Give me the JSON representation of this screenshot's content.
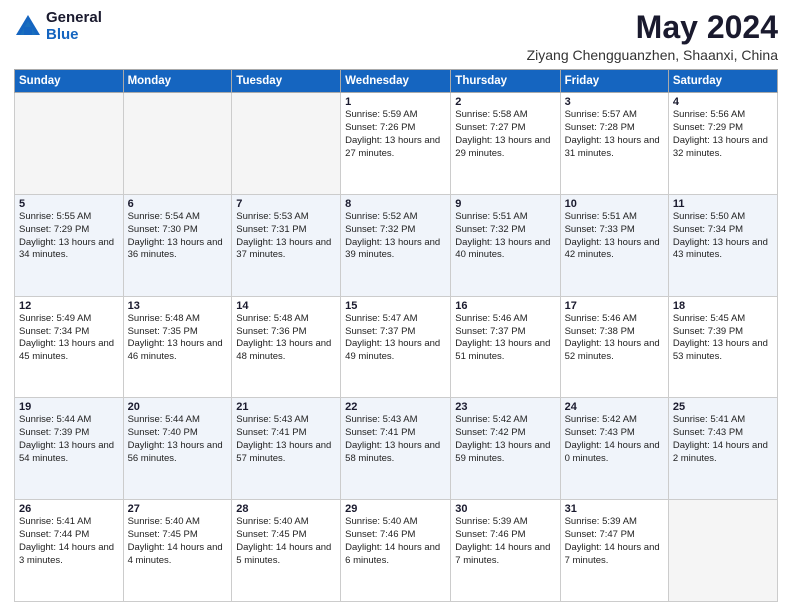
{
  "logo": {
    "general": "General",
    "blue": "Blue"
  },
  "title": "May 2024",
  "location": "Ziyang Chengguanzhen, Shaanxi, China",
  "days_of_week": [
    "Sunday",
    "Monday",
    "Tuesday",
    "Wednesday",
    "Thursday",
    "Friday",
    "Saturday"
  ],
  "weeks": [
    [
      {
        "day": "",
        "sunrise": "",
        "sunset": "",
        "daylight": "",
        "empty": true
      },
      {
        "day": "",
        "sunrise": "",
        "sunset": "",
        "daylight": "",
        "empty": true
      },
      {
        "day": "",
        "sunrise": "",
        "sunset": "",
        "daylight": "",
        "empty": true
      },
      {
        "day": "1",
        "sunrise": "Sunrise: 5:59 AM",
        "sunset": "Sunset: 7:26 PM",
        "daylight": "Daylight: 13 hours and 27 minutes.",
        "empty": false
      },
      {
        "day": "2",
        "sunrise": "Sunrise: 5:58 AM",
        "sunset": "Sunset: 7:27 PM",
        "daylight": "Daylight: 13 hours and 29 minutes.",
        "empty": false
      },
      {
        "day": "3",
        "sunrise": "Sunrise: 5:57 AM",
        "sunset": "Sunset: 7:28 PM",
        "daylight": "Daylight: 13 hours and 31 minutes.",
        "empty": false
      },
      {
        "day": "4",
        "sunrise": "Sunrise: 5:56 AM",
        "sunset": "Sunset: 7:29 PM",
        "daylight": "Daylight: 13 hours and 32 minutes.",
        "empty": false
      }
    ],
    [
      {
        "day": "5",
        "sunrise": "Sunrise: 5:55 AM",
        "sunset": "Sunset: 7:29 PM",
        "daylight": "Daylight: 13 hours and 34 minutes.",
        "empty": false
      },
      {
        "day": "6",
        "sunrise": "Sunrise: 5:54 AM",
        "sunset": "Sunset: 7:30 PM",
        "daylight": "Daylight: 13 hours and 36 minutes.",
        "empty": false
      },
      {
        "day": "7",
        "sunrise": "Sunrise: 5:53 AM",
        "sunset": "Sunset: 7:31 PM",
        "daylight": "Daylight: 13 hours and 37 minutes.",
        "empty": false
      },
      {
        "day": "8",
        "sunrise": "Sunrise: 5:52 AM",
        "sunset": "Sunset: 7:32 PM",
        "daylight": "Daylight: 13 hours and 39 minutes.",
        "empty": false
      },
      {
        "day": "9",
        "sunrise": "Sunrise: 5:51 AM",
        "sunset": "Sunset: 7:32 PM",
        "daylight": "Daylight: 13 hours and 40 minutes.",
        "empty": false
      },
      {
        "day": "10",
        "sunrise": "Sunrise: 5:51 AM",
        "sunset": "Sunset: 7:33 PM",
        "daylight": "Daylight: 13 hours and 42 minutes.",
        "empty": false
      },
      {
        "day": "11",
        "sunrise": "Sunrise: 5:50 AM",
        "sunset": "Sunset: 7:34 PM",
        "daylight": "Daylight: 13 hours and 43 minutes.",
        "empty": false
      }
    ],
    [
      {
        "day": "12",
        "sunrise": "Sunrise: 5:49 AM",
        "sunset": "Sunset: 7:34 PM",
        "daylight": "Daylight: 13 hours and 45 minutes.",
        "empty": false
      },
      {
        "day": "13",
        "sunrise": "Sunrise: 5:48 AM",
        "sunset": "Sunset: 7:35 PM",
        "daylight": "Daylight: 13 hours and 46 minutes.",
        "empty": false
      },
      {
        "day": "14",
        "sunrise": "Sunrise: 5:48 AM",
        "sunset": "Sunset: 7:36 PM",
        "daylight": "Daylight: 13 hours and 48 minutes.",
        "empty": false
      },
      {
        "day": "15",
        "sunrise": "Sunrise: 5:47 AM",
        "sunset": "Sunset: 7:37 PM",
        "daylight": "Daylight: 13 hours and 49 minutes.",
        "empty": false
      },
      {
        "day": "16",
        "sunrise": "Sunrise: 5:46 AM",
        "sunset": "Sunset: 7:37 PM",
        "daylight": "Daylight: 13 hours and 51 minutes.",
        "empty": false
      },
      {
        "day": "17",
        "sunrise": "Sunrise: 5:46 AM",
        "sunset": "Sunset: 7:38 PM",
        "daylight": "Daylight: 13 hours and 52 minutes.",
        "empty": false
      },
      {
        "day": "18",
        "sunrise": "Sunrise: 5:45 AM",
        "sunset": "Sunset: 7:39 PM",
        "daylight": "Daylight: 13 hours and 53 minutes.",
        "empty": false
      }
    ],
    [
      {
        "day": "19",
        "sunrise": "Sunrise: 5:44 AM",
        "sunset": "Sunset: 7:39 PM",
        "daylight": "Daylight: 13 hours and 54 minutes.",
        "empty": false
      },
      {
        "day": "20",
        "sunrise": "Sunrise: 5:44 AM",
        "sunset": "Sunset: 7:40 PM",
        "daylight": "Daylight: 13 hours and 56 minutes.",
        "empty": false
      },
      {
        "day": "21",
        "sunrise": "Sunrise: 5:43 AM",
        "sunset": "Sunset: 7:41 PM",
        "daylight": "Daylight: 13 hours and 57 minutes.",
        "empty": false
      },
      {
        "day": "22",
        "sunrise": "Sunrise: 5:43 AM",
        "sunset": "Sunset: 7:41 PM",
        "daylight": "Daylight: 13 hours and 58 minutes.",
        "empty": false
      },
      {
        "day": "23",
        "sunrise": "Sunrise: 5:42 AM",
        "sunset": "Sunset: 7:42 PM",
        "daylight": "Daylight: 13 hours and 59 minutes.",
        "empty": false
      },
      {
        "day": "24",
        "sunrise": "Sunrise: 5:42 AM",
        "sunset": "Sunset: 7:43 PM",
        "daylight": "Daylight: 14 hours and 0 minutes.",
        "empty": false
      },
      {
        "day": "25",
        "sunrise": "Sunrise: 5:41 AM",
        "sunset": "Sunset: 7:43 PM",
        "daylight": "Daylight: 14 hours and 2 minutes.",
        "empty": false
      }
    ],
    [
      {
        "day": "26",
        "sunrise": "Sunrise: 5:41 AM",
        "sunset": "Sunset: 7:44 PM",
        "daylight": "Daylight: 14 hours and 3 minutes.",
        "empty": false
      },
      {
        "day": "27",
        "sunrise": "Sunrise: 5:40 AM",
        "sunset": "Sunset: 7:45 PM",
        "daylight": "Daylight: 14 hours and 4 minutes.",
        "empty": false
      },
      {
        "day": "28",
        "sunrise": "Sunrise: 5:40 AM",
        "sunset": "Sunset: 7:45 PM",
        "daylight": "Daylight: 14 hours and 5 minutes.",
        "empty": false
      },
      {
        "day": "29",
        "sunrise": "Sunrise: 5:40 AM",
        "sunset": "Sunset: 7:46 PM",
        "daylight": "Daylight: 14 hours and 6 minutes.",
        "empty": false
      },
      {
        "day": "30",
        "sunrise": "Sunrise: 5:39 AM",
        "sunset": "Sunset: 7:46 PM",
        "daylight": "Daylight: 14 hours and 7 minutes.",
        "empty": false
      },
      {
        "day": "31",
        "sunrise": "Sunrise: 5:39 AM",
        "sunset": "Sunset: 7:47 PM",
        "daylight": "Daylight: 14 hours and 7 minutes.",
        "empty": false
      },
      {
        "day": "",
        "sunrise": "",
        "sunset": "",
        "daylight": "",
        "empty": true
      }
    ]
  ]
}
